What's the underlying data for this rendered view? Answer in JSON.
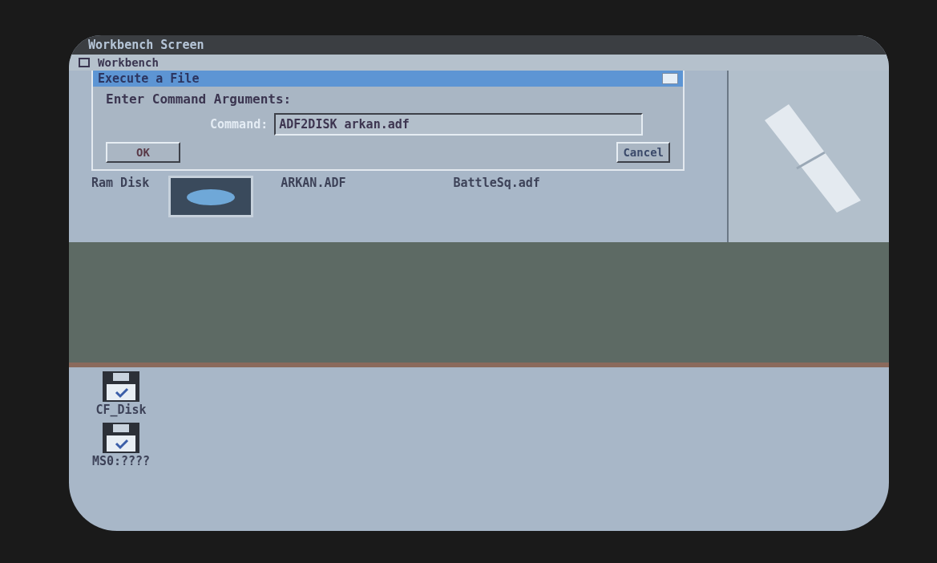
{
  "screen": {
    "title": "Workbench Screen"
  },
  "window": {
    "title": "Workbench"
  },
  "dialog": {
    "title": "Execute a File",
    "prompt": "Enter Command Arguments:",
    "field_label": "Command:",
    "value": "ADF2DISK arkan.adf",
    "buttons": [
      {
        "label": "OK"
      },
      {
        "label": "Cancel"
      }
    ]
  },
  "volumes": [
    {
      "label": "Ram Disk"
    }
  ],
  "files": [
    {
      "label": "ARKAN.ADF"
    },
    {
      "label": "BattleSq.adf"
    }
  ],
  "desktop_icons": [
    {
      "label": "CF_Disk"
    },
    {
      "label": "MS0:????"
    }
  ]
}
